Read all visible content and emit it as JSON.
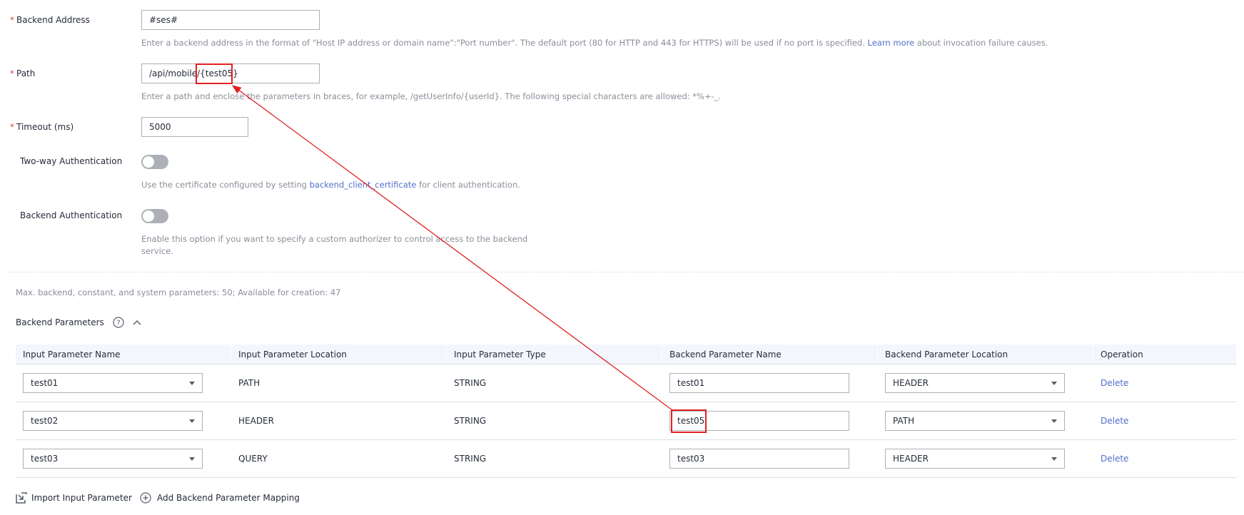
{
  "form": {
    "backend_address": {
      "label": "Backend Address",
      "required_mark": "*",
      "value": "#ses#",
      "hint_prefix": "Enter a backend address in the format of \"Host IP address or domain name\":\"Port number\". The default port (80 for HTTP and 443 for HTTPS) will be used if no port is specified. ",
      "hint_link": "Learn more",
      "hint_suffix": " about invocation failure causes."
    },
    "path": {
      "label": "Path",
      "required_mark": "*",
      "value_prefix": "/api/mobile/",
      "value_param": "{test05}",
      "hint": "Enter a path and enclose the parameters in braces, for example, /getUserInfo/{userId}. The following special characters are allowed: *%+-_."
    },
    "timeout": {
      "label": "Timeout (ms)",
      "required_mark": "*",
      "value": "5000"
    },
    "two_way_auth": {
      "label": "Two-way Authentication",
      "enabled": false,
      "hint_prefix": "Use the certificate configured by setting ",
      "hint_link": "backend_client_certificate",
      "hint_suffix": " for client authentication."
    },
    "backend_auth": {
      "label": "Backend Authentication",
      "enabled": false,
      "hint_line1": "Enable this option if you want to specify a custom authorizer to control access to the backend",
      "hint_line2": "service."
    }
  },
  "params_info": "Max. backend, constant, and system parameters: 50; Available for creation: 47",
  "backend_parameters": {
    "title": "Backend Parameters",
    "help_icon": "question-circle-icon",
    "collapse_icon": "chevron-up-icon",
    "columns": [
      "Input Parameter Name",
      "Input Parameter Location",
      "Input Parameter Type",
      "Backend Parameter Name",
      "Backend Parameter Location",
      "Operation"
    ],
    "rows": [
      {
        "input_name": "test01",
        "input_location": "PATH",
        "input_type": "STRING",
        "backend_name": "test01",
        "backend_location": "HEADER",
        "operation": "Delete"
      },
      {
        "input_name": "test02",
        "input_location": "HEADER",
        "input_type": "STRING",
        "backend_name": "test05",
        "backend_location": "PATH",
        "operation": "Delete"
      },
      {
        "input_name": "test03",
        "input_location": "QUERY",
        "input_type": "STRING",
        "backend_name": "test03",
        "backend_location": "HEADER",
        "operation": "Delete"
      }
    ]
  },
  "footer": {
    "import_label": "Import Input Parameter",
    "import_icon": "import-icon",
    "add_label": "Add Backend Parameter Mapping",
    "add_icon": "plus-circle-icon"
  },
  "annotation": {
    "color": "#e02020",
    "description": "Arrow from backend parameter name test05 to path parameter {test05}"
  }
}
